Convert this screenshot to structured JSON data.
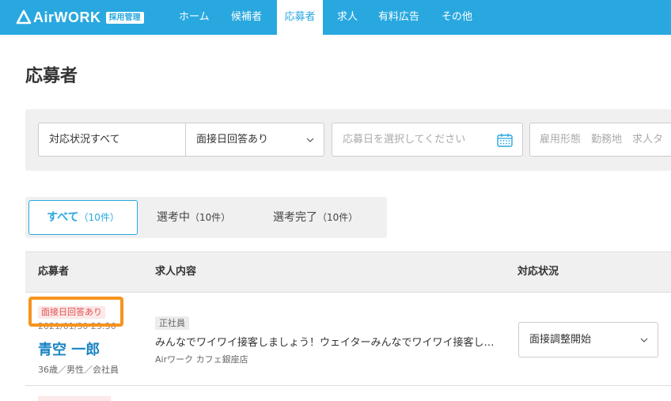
{
  "header": {
    "logo_text": "AirWORK",
    "logo_badge": "採用管理",
    "nav": [
      {
        "label": "ホーム",
        "active": false
      },
      {
        "label": "候補者",
        "active": false
      },
      {
        "label": "応募者",
        "active": true
      },
      {
        "label": "求人",
        "active": false
      },
      {
        "label": "有料広告",
        "active": false
      },
      {
        "label": "その他",
        "active": false
      }
    ],
    "accent_color": "#29a8e0"
  },
  "page": {
    "title": "応募者"
  },
  "filters": {
    "status_select": "対応状況すべて",
    "interview_select": "面接日回答あり",
    "date_placeholder": "応募日を選択してください",
    "keyword_placeholder": "雇用形態　勤務地　求人タ"
  },
  "tabs": [
    {
      "label": "すべて",
      "count": "（10件）",
      "active": true
    },
    {
      "label": "選考中",
      "count": "（10件）",
      "active": false
    },
    {
      "label": "選考完了",
      "count": "（10件）",
      "active": false
    }
  ],
  "table": {
    "headers": [
      "応募者",
      "求人内容",
      "対応状況"
    ],
    "rows": [
      {
        "badge": "面接日回答あり",
        "applied_at": "2021/01/30 23:36",
        "name": "青空 一郎",
        "meta": "36歳／男性／会社員",
        "employment_type": "正社員",
        "job_title": "みんなでワイワイ接客しましょう！ウェイターみんなでワイワイ接客しましょう！ウェイター",
        "store": "Airワーク カフェ銀座店",
        "status": "面接調整開始"
      }
    ]
  },
  "icons": {
    "chevron": "chevron-down-icon",
    "calendar": "calendar-icon",
    "logo": "airwork-logo-icon"
  },
  "highlight_color": "#f7931e"
}
